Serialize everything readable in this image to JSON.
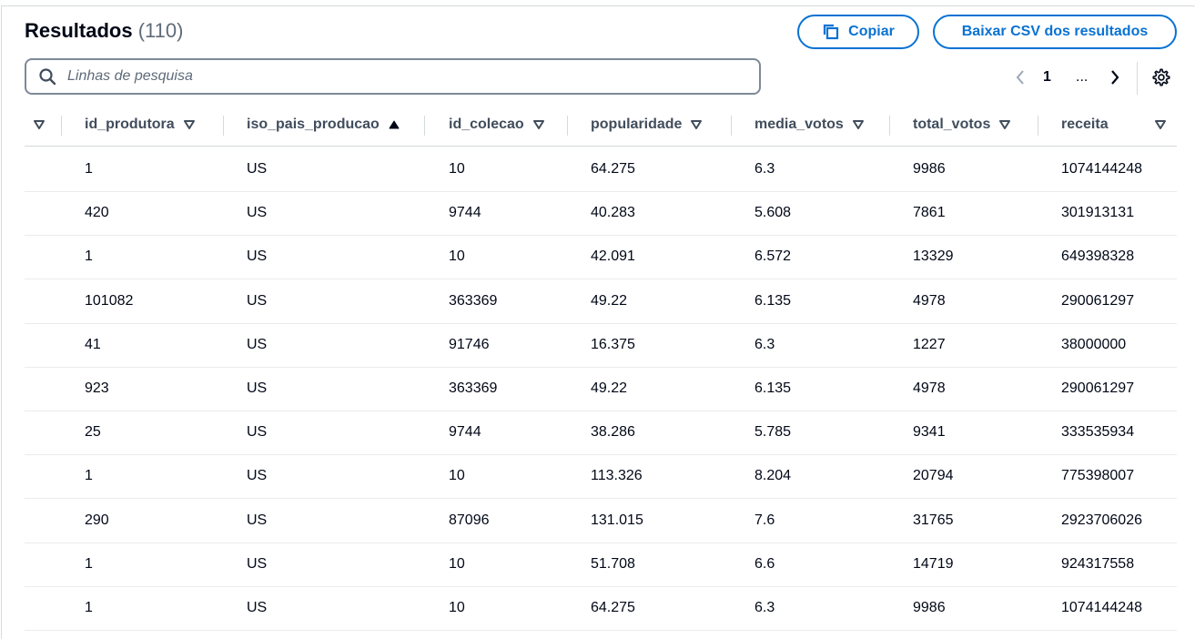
{
  "header": {
    "title": "Resultados",
    "count": "(110)",
    "copy_label": "Copiar",
    "csv_label": "Baixar CSV dos resultados"
  },
  "search": {
    "placeholder": "Linhas de pesquisa",
    "value": ""
  },
  "pagination": {
    "current_page": "1",
    "ellipsis": "..."
  },
  "table": {
    "columns": [
      {
        "key": "id_produtora",
        "label": "id_produtora",
        "sort": "none"
      },
      {
        "key": "iso_pais_producao",
        "label": "iso_pais_producao",
        "sort": "ascending"
      },
      {
        "key": "id_colecao",
        "label": "id_colecao",
        "sort": "none"
      },
      {
        "key": "popularidade",
        "label": "popularidade",
        "sort": "none"
      },
      {
        "key": "media_votos",
        "label": "media_votos",
        "sort": "none"
      },
      {
        "key": "total_votos",
        "label": "total_votos",
        "sort": "none"
      },
      {
        "key": "receita",
        "label": "receita",
        "sort": "none"
      }
    ],
    "rows": [
      [
        "1",
        "US",
        "10",
        "64.275",
        "6.3",
        "9986",
        "1074144248"
      ],
      [
        "420",
        "US",
        "9744",
        "40.283",
        "5.608",
        "7861",
        "301913131"
      ],
      [
        "1",
        "US",
        "10",
        "42.091",
        "6.572",
        "13329",
        "649398328"
      ],
      [
        "101082",
        "US",
        "363369",
        "49.22",
        "6.135",
        "4978",
        "290061297"
      ],
      [
        "41",
        "US",
        "91746",
        "16.375",
        "6.3",
        "1227",
        "38000000"
      ],
      [
        "923",
        "US",
        "363369",
        "49.22",
        "6.135",
        "4978",
        "290061297"
      ],
      [
        "25",
        "US",
        "9744",
        "38.286",
        "5.785",
        "9341",
        "333535934"
      ],
      [
        "1",
        "US",
        "10",
        "113.326",
        "8.204",
        "20794",
        "775398007"
      ],
      [
        "290",
        "US",
        "87096",
        "131.015",
        "7.6",
        "31765",
        "2923706026"
      ],
      [
        "1",
        "US",
        "10",
        "51.708",
        "6.6",
        "14719",
        "924317558"
      ],
      [
        "1",
        "US",
        "10",
        "64.275",
        "6.3",
        "9986",
        "1074144248"
      ]
    ]
  },
  "colors": {
    "accent": "#0972d3",
    "text": "#000716",
    "muted": "#5f6b7a",
    "border": "#d5dbdb"
  },
  "icons": [
    "copy-icon",
    "search-icon",
    "chevron-left-icon",
    "chevron-right-icon",
    "gear-icon",
    "sort-down-icon",
    "sort-up-icon"
  ]
}
